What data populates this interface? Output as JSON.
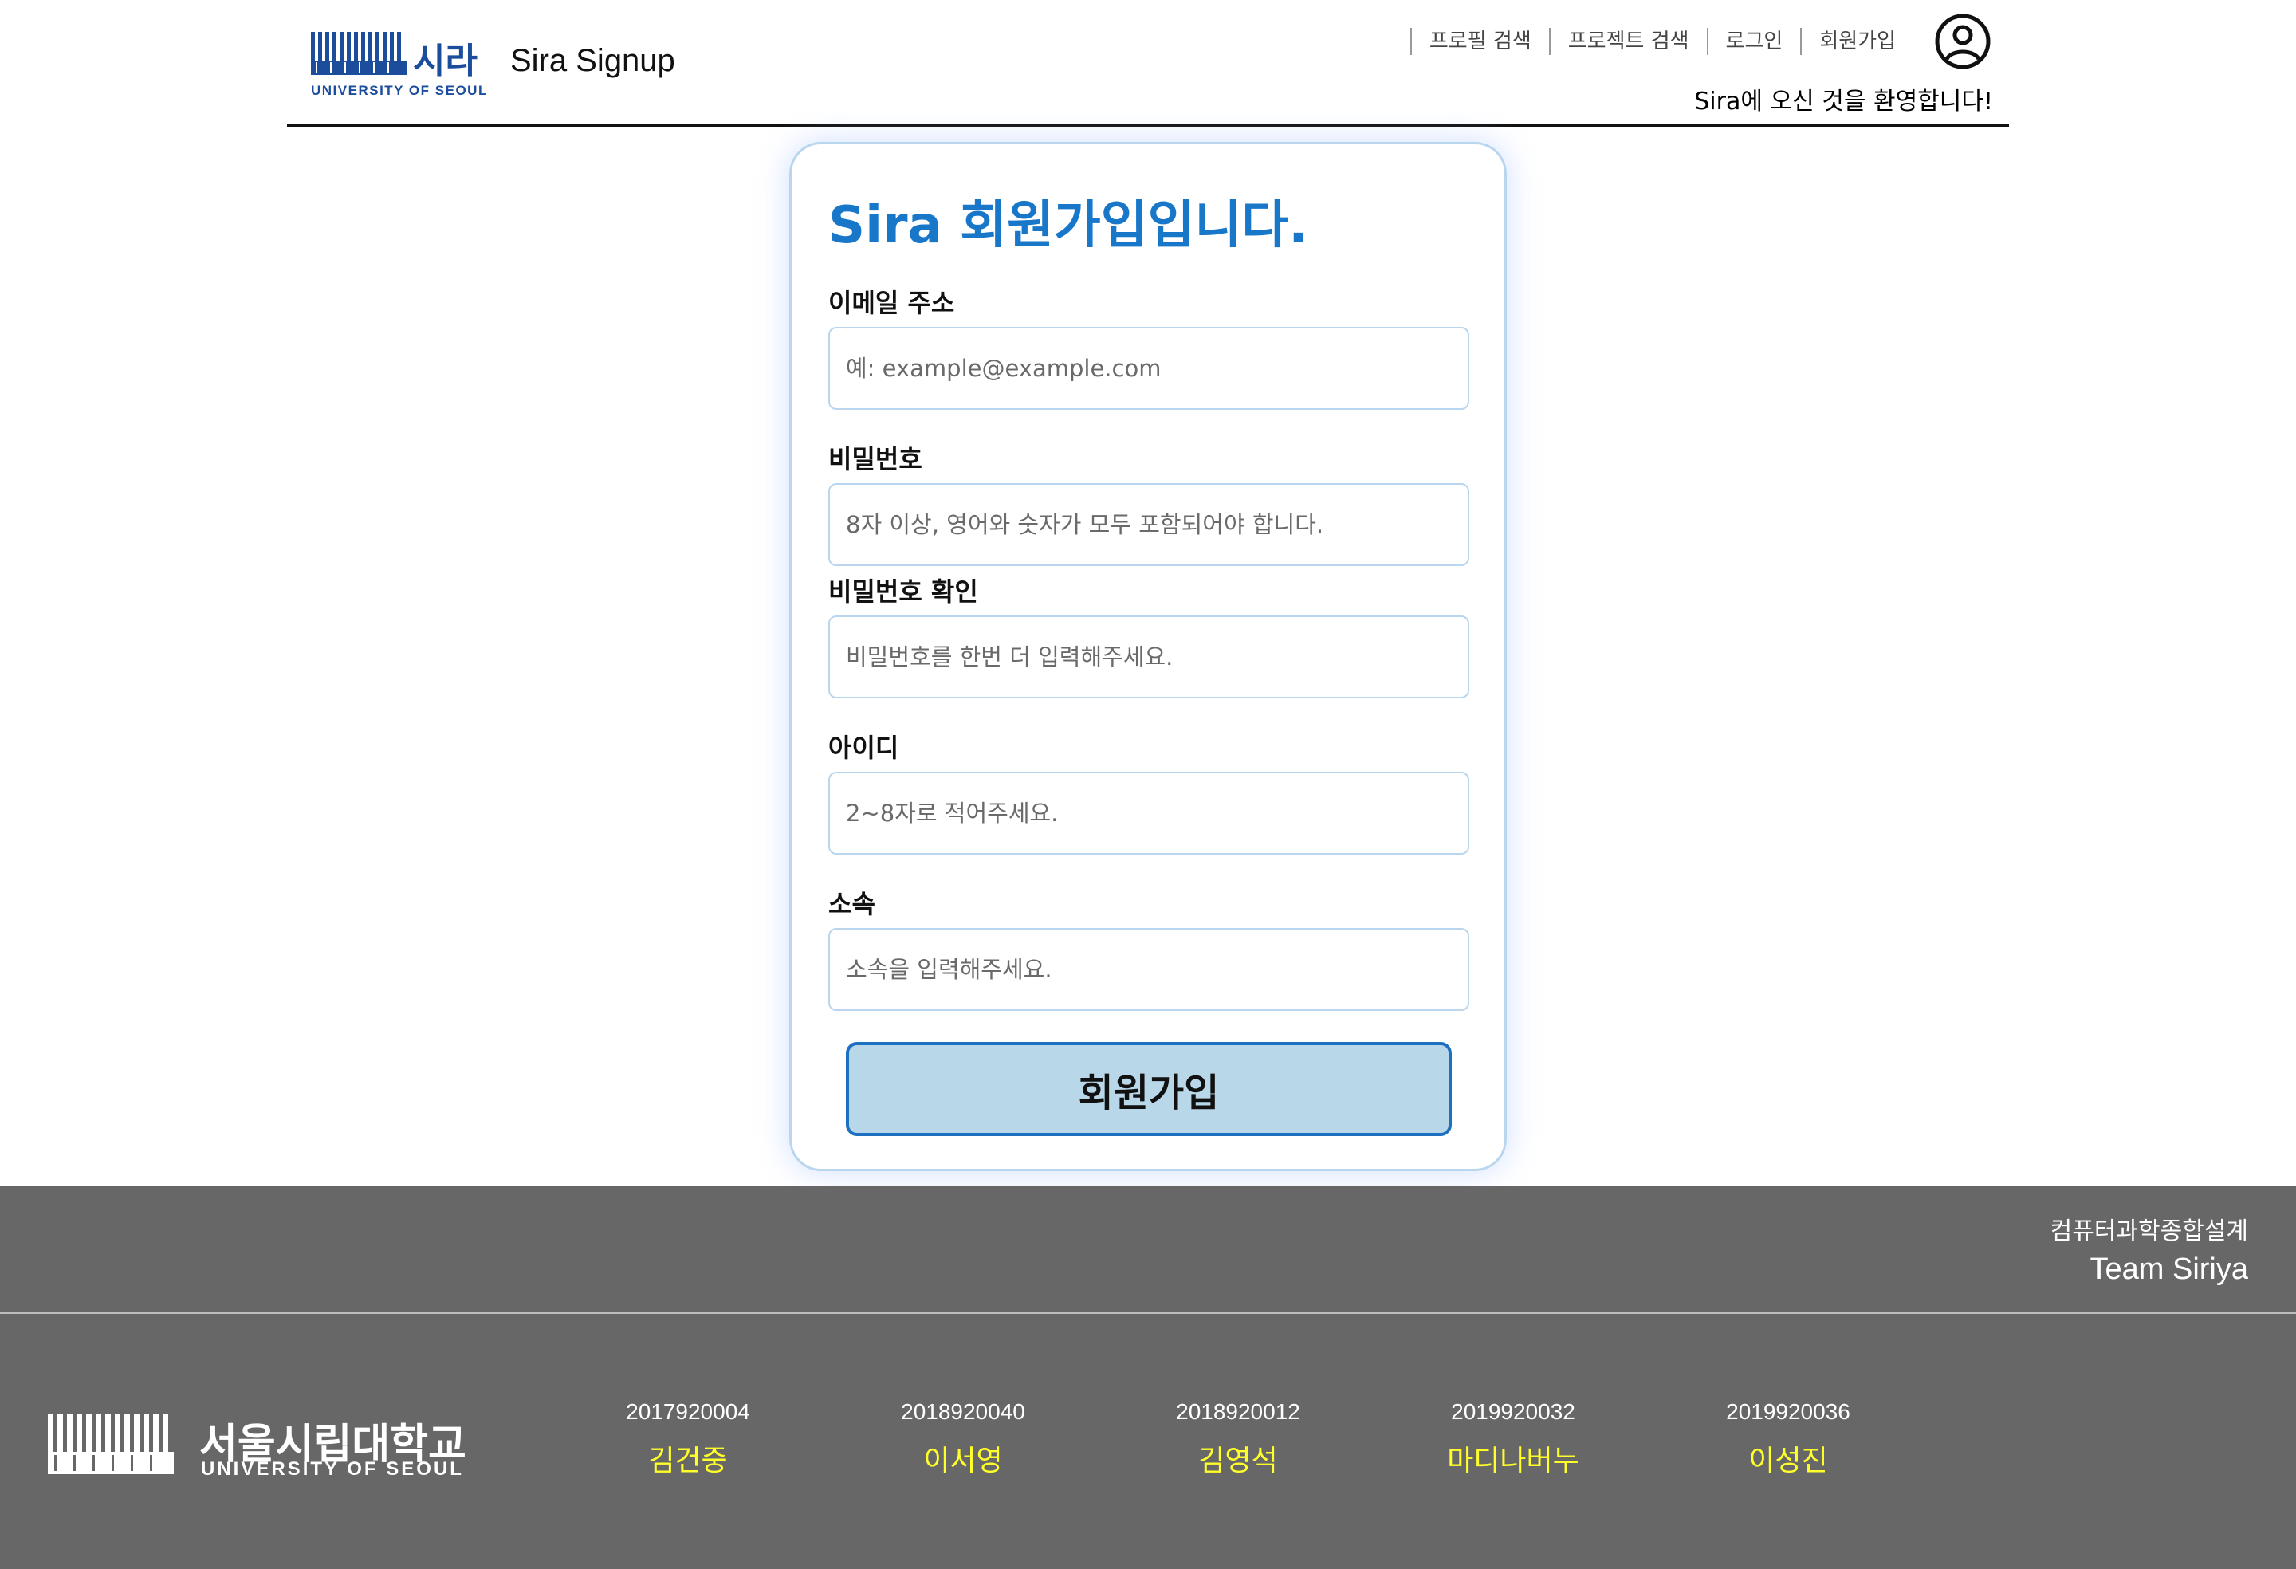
{
  "header": {
    "logo_ko": "시라",
    "logo_en": "UNIVERSITY OF SEOUL",
    "site_title": "Sira Signup",
    "nav": [
      {
        "label": "프로필 검색"
      },
      {
        "label": "프로젝트 검색"
      },
      {
        "label": "로그인"
      },
      {
        "label": "회원가입"
      }
    ],
    "profile_icon": "user-circle-icon",
    "welcome": "Sira에 오신 것을 환영합니다!"
  },
  "form": {
    "title": "Sira 회원가입입니다.",
    "fields": [
      {
        "label": "이메일 주소",
        "placeholder": "예: example@example.com",
        "value": ""
      },
      {
        "label": "비밀번호",
        "placeholder": "8자 이상, 영어와 숫자가 모두 포함되어야 합니다.",
        "value": ""
      },
      {
        "label": "비밀번호 확인",
        "placeholder": "비밀번호를 한번 더 입력해주세요.",
        "value": ""
      },
      {
        "label": "아이디",
        "placeholder": "2~8자로 적어주세요.",
        "value": ""
      },
      {
        "label": "소속",
        "placeholder": "소속을 입력해주세요.",
        "value": ""
      }
    ],
    "submit_label": "회원가입"
  },
  "footer": {
    "course": "컴퓨터과학종합설계",
    "team": "Team Siriya",
    "logo_ko": "서울시립대학교",
    "logo_en": "UNIVERSITY OF SEOUL",
    "members": [
      {
        "id": "2017920004",
        "name": "김건중"
      },
      {
        "id": "2018920040",
        "name": "이서영"
      },
      {
        "id": "2018920012",
        "name": "김영석"
      },
      {
        "id": "2019920032",
        "name": "마디나버누"
      },
      {
        "id": "2019920036",
        "name": "이성진"
      }
    ]
  },
  "colors": {
    "accent": "#1877c9",
    "logo_blue": "#1b4d9c",
    "button_bg": "#b8d8ea",
    "button_border": "#1d6fbf",
    "footer_bg": "#676767",
    "member_name": "#ffff2a"
  }
}
